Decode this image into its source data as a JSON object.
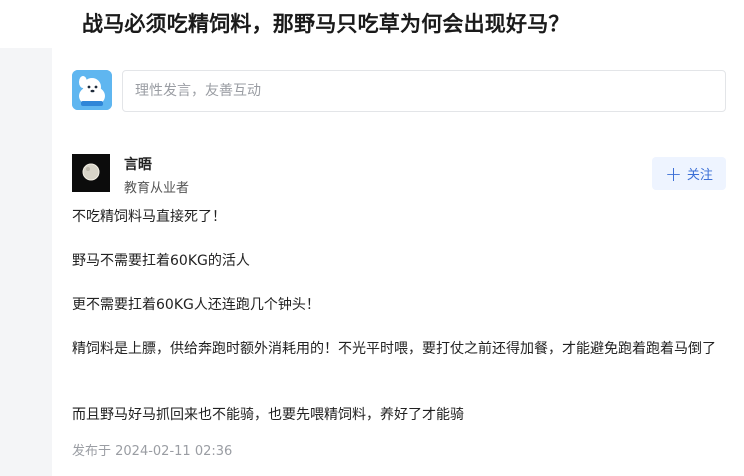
{
  "header": {
    "title": "战马必须吃精饲料，那野马只吃草为何会出现好马？"
  },
  "comment_box": {
    "placeholder": "理性发言，友善互动"
  },
  "author": {
    "name": "言晤",
    "role": "教育从业者",
    "follow_label": "关注"
  },
  "post": {
    "paragraphs": [
      "不吃精饲料马直接死了！",
      "野马不需要扛着60KG的活人",
      "更不需要扛着60KG人还连跑几个钟头！",
      "精饲料是上膘，供给奔跑时额外消耗用的！不光平时喂，要打仗之前还得加餐，才能避免跑着跑着马倒了",
      "而且野马好马抓回来也不能骑，也要先喂精饲料，养好了才能骑"
    ],
    "published": "发布于 2024-02-11 02:36"
  },
  "colors": {
    "accent": "#3b6fd6",
    "follow_bg": "#eef4ff",
    "avatar_blue": "#5fb6f0"
  }
}
